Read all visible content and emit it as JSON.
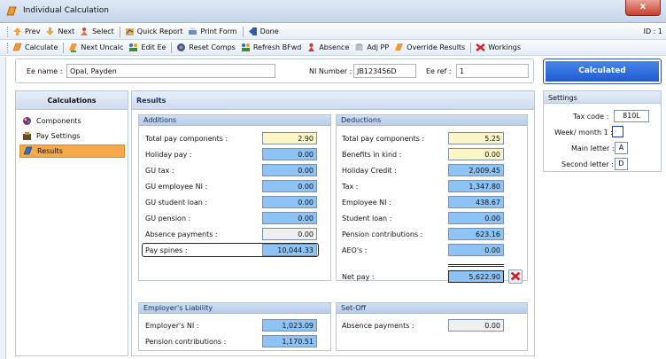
{
  "window": {
    "title": "Individual Calculation",
    "close_label": "x",
    "id_label": "ID : 1"
  },
  "toolbar1": {
    "prev": "Prev",
    "next": "Next",
    "select": "Select",
    "quick_report": "Quick Report",
    "print_form": "Print Form",
    "done": "Done"
  },
  "toolbar2": {
    "calculate": "Calculate",
    "next_uncalc": "Next Uncalc",
    "edit_ee": "Edit Ee",
    "reset_comps": "Reset Comps",
    "refresh_bfwd": "Refresh BFwd",
    "absence": "Absence",
    "adj_pp": "Adj PP",
    "override_results": "Override Results",
    "workings": "Workings"
  },
  "employee": {
    "ee_name_label": "Ee name :",
    "ee_name": "Opal, Payden",
    "ni_label": "NI Number :",
    "ni_number": "JB123456D",
    "ee_ref_label": "Ee ref :",
    "ee_ref": "1"
  },
  "status_button": "Calculated",
  "settings": {
    "title": "Settings",
    "tax_code_label": "Tax code :",
    "tax_code": "810L",
    "week_month_label": "Week/ month 1 :",
    "main_letter_label": "Main letter :",
    "main_letter": "A",
    "second_letter_label": "Second letter :",
    "second_letter": "D"
  },
  "calculations": {
    "title": "Calculations",
    "items": [
      "Components",
      "Pay Settings",
      "Results"
    ],
    "selected": "Results"
  },
  "results": {
    "title": "Results",
    "additions": {
      "title": "Additions",
      "rows": [
        {
          "label": "Total pay components :",
          "value": "2.90"
        },
        {
          "label": "Holiday pay :",
          "value": "0.00"
        },
        {
          "label": "GU tax :",
          "value": "0.00"
        },
        {
          "label": "GU employee NI :",
          "value": "0.00"
        },
        {
          "label": "GU student loan :",
          "value": "0.00"
        },
        {
          "label": "GU pension :",
          "value": "0.00"
        },
        {
          "label": "Absence payments :",
          "value": "0.00"
        },
        {
          "label": "Pay spines :",
          "value": "10,044.33"
        }
      ]
    },
    "deductions": {
      "title": "Deductions",
      "rows": [
        {
          "label": "Total pay components :",
          "value": "5.25"
        },
        {
          "label": "Benefits in kind :",
          "value": "0.00"
        },
        {
          "label": "Holiday Credit :",
          "value": "2,009.45"
        },
        {
          "label": "Tax :",
          "value": "1,347.80"
        },
        {
          "label": "Employee NI :",
          "value": "438.67"
        },
        {
          "label": "Student loan :",
          "value": "0.00"
        },
        {
          "label": "Pension contributions :",
          "value": "623.16"
        },
        {
          "label": "AEO's :",
          "value": "0.00"
        }
      ],
      "net_pay_label": "Net pay :",
      "net_pay": "5,622.90"
    },
    "employer_liability": {
      "title": "Employer's Liability",
      "rows": [
        {
          "label": "Employer's NI :",
          "value": "1,023.09"
        },
        {
          "label": "Pension contributions :",
          "value": "1,170.51"
        }
      ]
    },
    "set_off": {
      "title": "Set-Off",
      "rows": [
        {
          "label": "Absence payments :",
          "value": "0.00"
        }
      ]
    }
  },
  "colors": {
    "accent": "#1d5bd0",
    "selected_nav": "#f5a94a",
    "value_blue": "#8ec4f5",
    "value_yellow": "#fbf6c8"
  }
}
